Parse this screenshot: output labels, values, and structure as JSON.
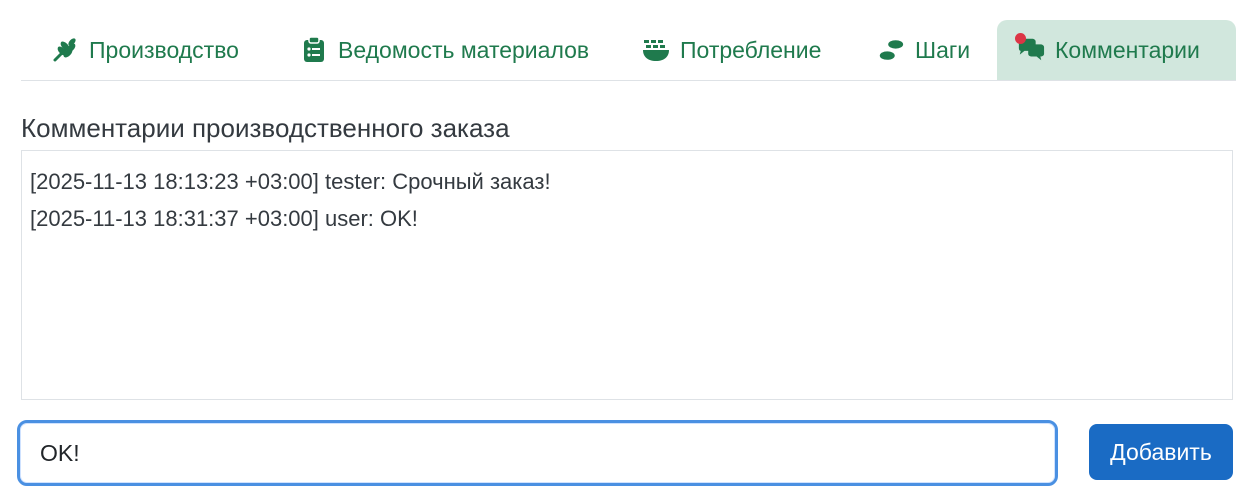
{
  "tabs": [
    {
      "label": "Производство",
      "icon": "wheat-icon",
      "active": false
    },
    {
      "label": "Ведомость материалов",
      "icon": "clipboard-list-icon",
      "active": false
    },
    {
      "label": "Потребление",
      "icon": "bowl-food-icon",
      "active": false
    },
    {
      "label": "Шаги",
      "icon": "footprints-icon",
      "active": false
    },
    {
      "label": "Комментарии",
      "icon": "comments-icon",
      "active": true
    }
  ],
  "section": {
    "title": "Комментарии производственного заказа"
  },
  "comments": [
    "[2025-11-13 18:13:23 +03:00] tester: Срочный заказ!",
    "[2025-11-13 18:31:37 +03:00] user: OK!"
  ],
  "input": {
    "value": "OK!"
  },
  "add_button": {
    "label": "Добавить"
  },
  "colors": {
    "accent_green": "#1f7a4d",
    "active_tab_bg": "#d1e7dd",
    "primary_button": "#1a6bc4",
    "notification_dot": "#dc3545",
    "input_focus_border": "#4a90e2"
  }
}
